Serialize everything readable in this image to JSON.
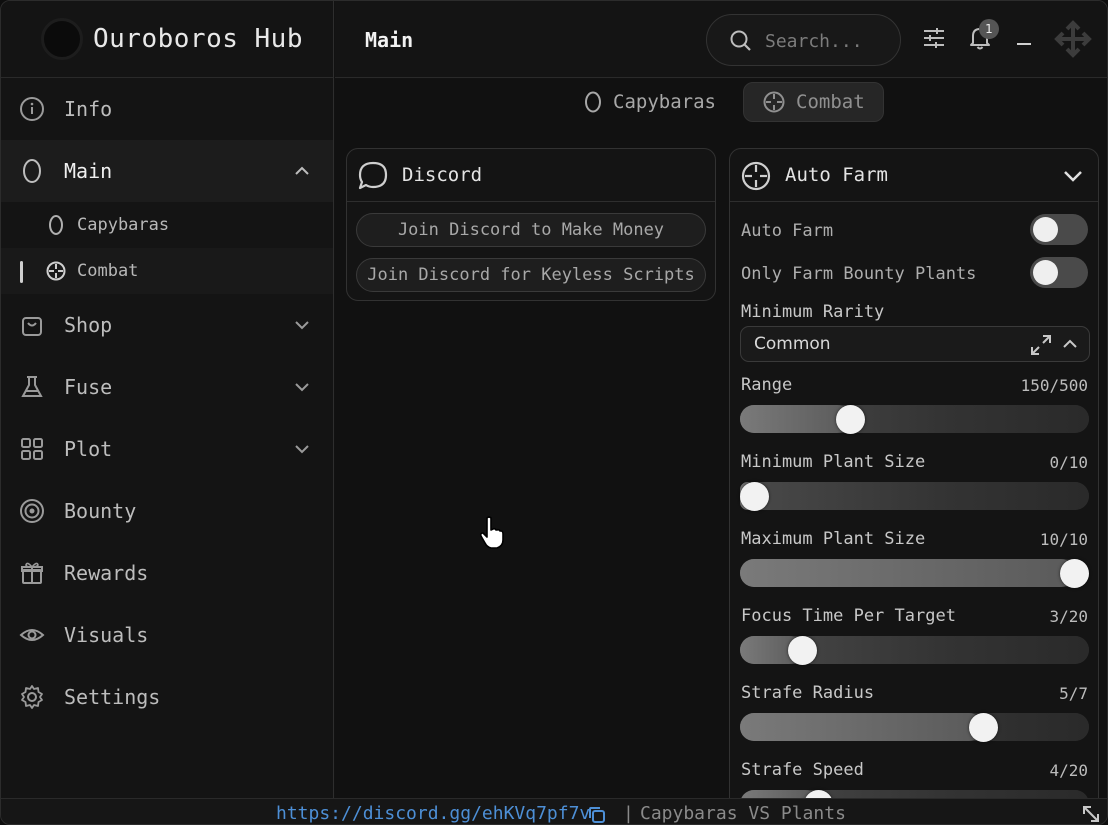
{
  "app": {
    "title": "Ouroboros Hub"
  },
  "header": {
    "page_title": "Main",
    "search_placeholder": "Search...",
    "notification_count": "1"
  },
  "sidebar": {
    "items": [
      {
        "label": "Info",
        "icon": "info-icon"
      },
      {
        "label": "Main",
        "icon": "capybara-icon",
        "expanded": true,
        "children": [
          {
            "label": "Capybaras",
            "icon": "capybara-icon"
          },
          {
            "label": "Combat",
            "icon": "crosshair-icon",
            "selected": true
          }
        ]
      },
      {
        "label": "Shop",
        "icon": "shop-bag-icon"
      },
      {
        "label": "Fuse",
        "icon": "flask-icon"
      },
      {
        "label": "Plot",
        "icon": "grid-icon"
      },
      {
        "label": "Bounty",
        "icon": "target-icon"
      },
      {
        "label": "Rewards",
        "icon": "gift-icon"
      },
      {
        "label": "Visuals",
        "icon": "eye-icon"
      },
      {
        "label": "Settings",
        "icon": "gear-icon"
      }
    ]
  },
  "tabs": [
    {
      "label": "Capybaras",
      "icon": "capybara-icon"
    },
    {
      "label": "Combat",
      "icon": "crosshair-icon",
      "active": true
    }
  ],
  "discord": {
    "title": "Discord",
    "buttons": [
      "Join Discord to Make Money",
      "Join Discord for Keyless Scripts"
    ]
  },
  "auto_farm": {
    "title": "Auto Farm",
    "toggles": [
      {
        "label": "Auto Farm",
        "on": false
      },
      {
        "label": "Only Farm Bounty Plants",
        "on": false
      }
    ],
    "dropdown": {
      "label": "Minimum Rarity",
      "value": "Common"
    },
    "sliders": [
      {
        "label": "Range",
        "value": 150,
        "max": 500,
        "display": "150/500"
      },
      {
        "label": "Minimum Plant Size",
        "value": 0,
        "max": 10,
        "display": "0/10"
      },
      {
        "label": "Maximum Plant Size",
        "value": 10,
        "max": 10,
        "display": "10/10"
      },
      {
        "label": "Focus Time Per Target",
        "value": 3,
        "max": 20,
        "display": "3/20"
      },
      {
        "label": "Strafe Radius",
        "value": 5,
        "max": 7,
        "display": "5/7"
      },
      {
        "label": "Strafe Speed",
        "value": 4,
        "max": 20,
        "display": "4/20"
      }
    ]
  },
  "footer": {
    "link": "https://discord.gg/ehKVq7pf7v",
    "separator": "|",
    "game": "Capybaras VS Plants"
  },
  "colors": {
    "accent_link": "#4d8fd6",
    "background": "#121212",
    "toggle_off": "#4a4a4a"
  }
}
